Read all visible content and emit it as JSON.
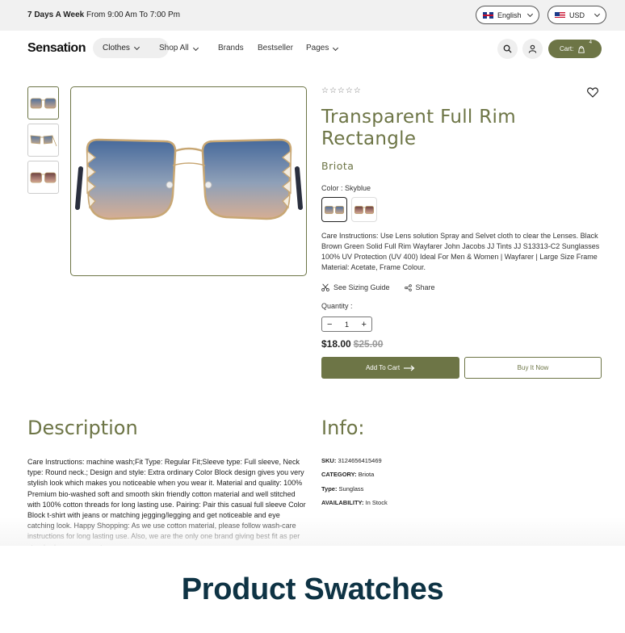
{
  "topbar": {
    "hours_bold": "7 Days A Week",
    "hours_rest": " From 9:00 Am To 7:00 Pm",
    "language": "English",
    "currency": "USD"
  },
  "nav": {
    "logo": "Sensation",
    "menu": [
      "Clothes",
      "Shop All",
      "Brands",
      "Bestseller",
      "Pages"
    ],
    "cart_label": "Cart:",
    "cart_count": "4"
  },
  "product": {
    "rating_stars": "☆☆☆☆☆",
    "title": "Transparent Full Rim Rectangle",
    "brand": "Briota",
    "color_label": "Color : Skyblue",
    "swatches": [
      "Skyblue",
      "Brown"
    ],
    "care_text": "Care Instructions: Use Lens solution Spray and Selvet cloth to clear the Lenses. Black Brown Green Solid Full Rim Wayfarer John Jacobs JJ Tints JJ S13313-C2 Sunglasses 100% UV Protection (UV 400) Ideal For Men & Women | Wayfarer | Large Size Frame Material: Acetate, Frame Colour.",
    "sizing_guide": "See Sizing Guide",
    "share": "Share",
    "quantity_label": "Quantity :",
    "quantity": "1",
    "price": "$18.00",
    "price_old": "$25.00",
    "add_to_cart": "Add To Cart",
    "buy_now": "Buy It Now"
  },
  "description": {
    "heading": "Description",
    "body": "Care Instructions: machine wash;Fit Type: Regular Fit;Sleeve type: Full sleeve, Neck type: Round neck.; Design and style: Extra ordinary Color Block design gives you very stylish look which makes you noticeable when you wear it. Material and quality: 100% Premium bio-washed soft and smooth skin friendly cotton material and well stitched with 100% cotton threads for long lasting use. Pairing: Pair this casual full sleeve Color Block t-shirt with jeans or matching jegging/legging and get noticeable and eye catching look. Happy Shopping: As we use cotton material, please follow wash-care instructions for long lasting use. Also, we are the only one brand giving best fit as per standard measurements."
  },
  "info": {
    "heading": "Info:",
    "sku_label": "SKU:",
    "sku": "3124656415469",
    "category_label": "CATEGORY:",
    "category": "Briota",
    "type_label": "Type:",
    "type": "Sunglass",
    "availability_label": "AVAILABILITY:",
    "availability": "In Stock"
  },
  "banner": {
    "text": "Product Swatches"
  },
  "colors": {
    "accent": "#6d7546",
    "banner_text": "#0e3344"
  }
}
